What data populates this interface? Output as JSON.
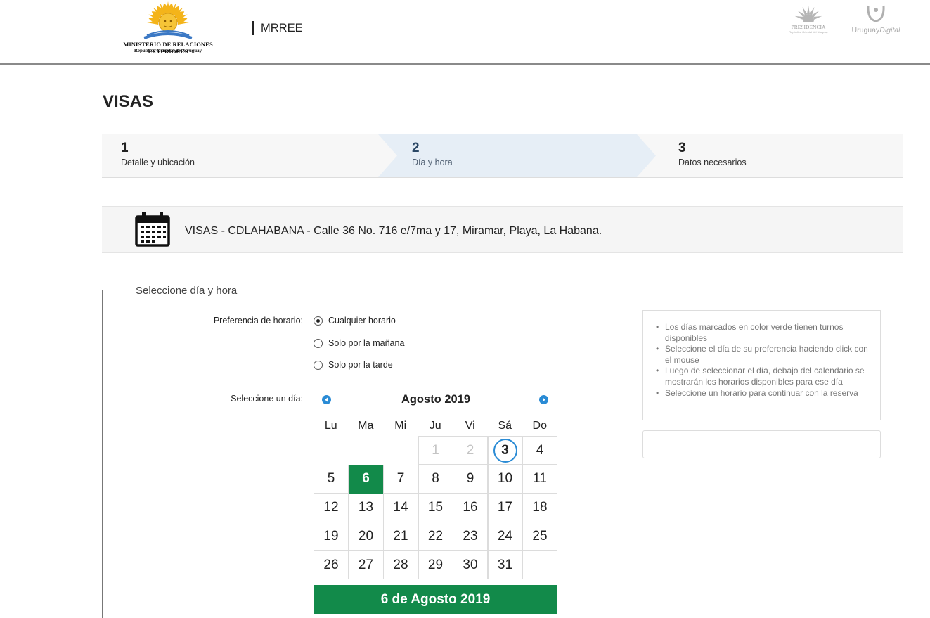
{
  "header": {
    "logo_main_line1": "MINISTERIO DE RELACIONES EXTERIORES",
    "logo_main_line2": "República Oriental del Uruguay",
    "brand": "MRREE",
    "logo_presidencia": "PRESIDENCIA",
    "logo_presidencia_sub": "República Oriental del Uruguay",
    "logo_ud_a": "Uruguay",
    "logo_ud_b": "Digital"
  },
  "page_title": "VISAS",
  "steps": [
    {
      "num": "1",
      "label": "Detalle y ubicación",
      "active": false
    },
    {
      "num": "2",
      "label": "Día y hora",
      "active": true
    },
    {
      "num": "3",
      "label": "Datos necesarios",
      "active": false
    }
  ],
  "location": {
    "icon": "calendar-icon",
    "text": "VISAS - CDLAHABANA - Calle 36 No. 716 e/7ma y 17, Miramar, Playa, La Habana."
  },
  "form": {
    "section_title": "Seleccione día y hora",
    "preference_label": "Preferencia de horario:",
    "options": [
      {
        "label": "Cualquier horario",
        "checked": true
      },
      {
        "label": "Solo por la mañana",
        "checked": false
      },
      {
        "label": "Solo por la tarde",
        "checked": false
      }
    ],
    "day_label": "Seleccione un día:"
  },
  "calendar": {
    "month": "Agosto 2019",
    "prev_icon": "chevron-left-icon",
    "next_icon": "chevron-right-icon",
    "weekdays": [
      "Lu",
      "Ma",
      "Mi",
      "Ju",
      "Vi",
      "Sá",
      "Do"
    ],
    "first_weekday_index": 3,
    "days_in_month": 31,
    "disabled_days": [
      1,
      2
    ],
    "today": 3,
    "selected": 6,
    "selected_label": "6 de Agosto 2019"
  },
  "info": {
    "items": [
      "Los días marcados en color verde tienen turnos disponibles",
      "Seleccione el día de su preferencia haciendo click con el mouse",
      "Luego de seleccionar el día, debajo del calendario se mostrarán los horarios disponibles para ese día",
      "Seleccione un horario para continuar con la reserva"
    ]
  },
  "colors": {
    "accent_green": "#128a4a",
    "accent_blue": "#2a8bd5",
    "step_active": "#e6eef6"
  }
}
